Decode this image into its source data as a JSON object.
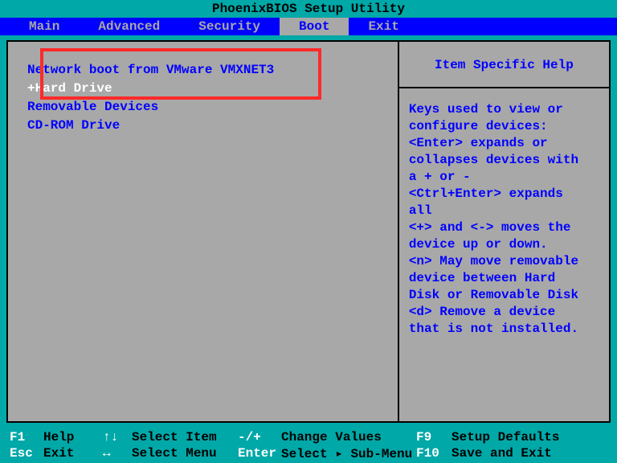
{
  "title": "PhoenixBIOS Setup Utility",
  "menu": {
    "items": [
      "Main",
      "Advanced",
      "Security",
      "Boot",
      "Exit"
    ],
    "active_index": 3
  },
  "boot": {
    "items": [
      {
        "label": "Network boot from VMware VMXNET3",
        "prefix": " ",
        "selected": false
      },
      {
        "label": "Hard Drive",
        "prefix": "+",
        "selected": true
      },
      {
        "label": "Removable Devices",
        "prefix": " ",
        "selected": false
      },
      {
        "label": "CD-ROM Drive",
        "prefix": " ",
        "selected": false
      }
    ]
  },
  "help": {
    "title": "Item Specific Help",
    "body": "Keys used to view or\nconfigure devices:\n<Enter> expands or\ncollapses devices with\na + or -\n<Ctrl+Enter> expands\nall\n<+> and <-> moves the\ndevice up or down.\n<n> May move removable\ndevice between Hard\nDisk or Removable Disk\n<d> Remove a device\nthat is not installed."
  },
  "footer": {
    "rows": [
      {
        "key": "F1",
        "label": "Help",
        "arrow": "↑↓",
        "action": "Select Item",
        "mid": "-/+",
        "action2": "Change Values",
        "key2": "F9",
        "label2": "Setup Defaults"
      },
      {
        "key": "Esc",
        "label": "Exit",
        "arrow": "↔",
        "action": "Select Menu",
        "mid": "Enter",
        "action2": "Select ▸ Sub-Menu",
        "key2": "F10",
        "label2": "Save and Exit"
      }
    ]
  }
}
